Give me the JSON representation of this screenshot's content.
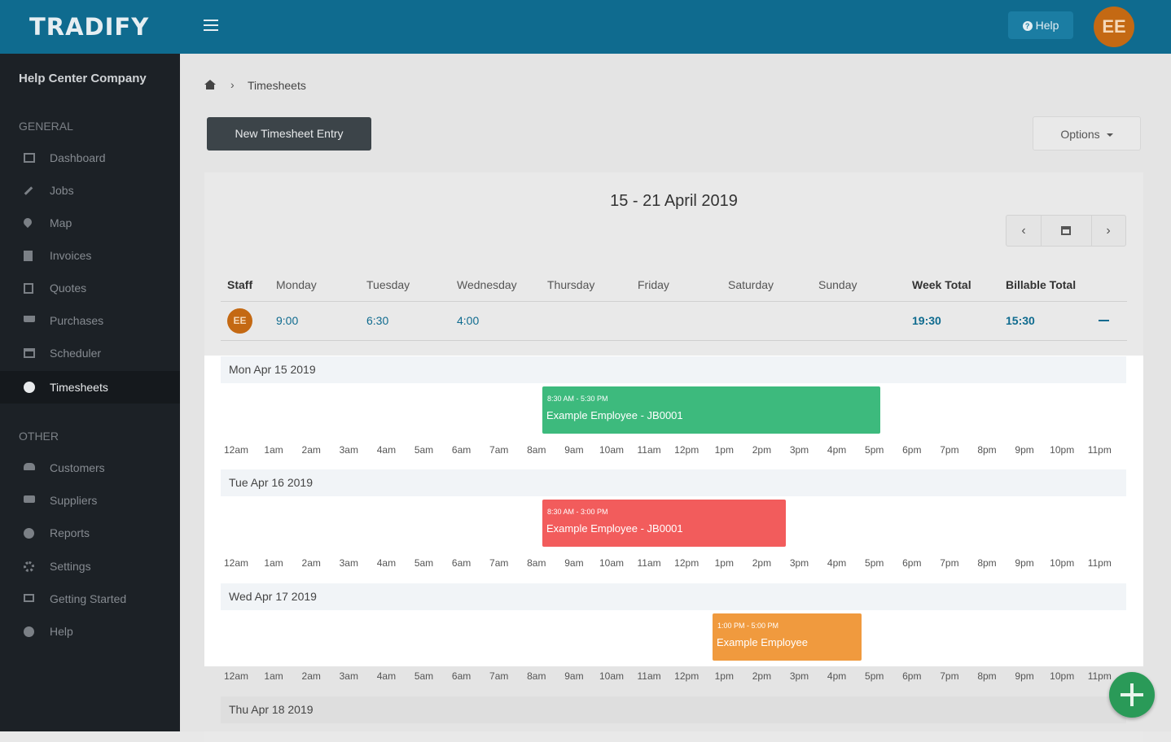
{
  "header": {
    "logo": "TRADIFY",
    "help_label": "Help",
    "user_initials": "EE"
  },
  "sidebar": {
    "company": "Help Center Company",
    "general_label": "GENERAL",
    "other_label": "OTHER",
    "general_items": [
      {
        "label": "Dashboard",
        "icon": "dashboard-icon"
      },
      {
        "label": "Jobs",
        "icon": "hammer-icon"
      },
      {
        "label": "Map",
        "icon": "map-pin-icon"
      },
      {
        "label": "Invoices",
        "icon": "invoice-icon"
      },
      {
        "label": "Quotes",
        "icon": "calculator-icon"
      },
      {
        "label": "Purchases",
        "icon": "cart-icon"
      },
      {
        "label": "Scheduler",
        "icon": "calendar-icon"
      },
      {
        "label": "Timesheets",
        "icon": "clock-icon",
        "active": true
      }
    ],
    "other_items": [
      {
        "label": "Customers",
        "icon": "users-icon"
      },
      {
        "label": "Suppliers",
        "icon": "truck-icon"
      },
      {
        "label": "Reports",
        "icon": "pie-chart-icon"
      },
      {
        "label": "Settings",
        "icon": "gear-icon"
      },
      {
        "label": "Getting Started",
        "icon": "thumbs-up-icon"
      },
      {
        "label": "Help",
        "icon": "question-icon"
      }
    ]
  },
  "breadcrumb": {
    "current": "Timesheets"
  },
  "toolbar": {
    "new_entry_label": "New Timesheet Entry",
    "options_label": "Options"
  },
  "week": {
    "title": "15 - 21 April 2019"
  },
  "table": {
    "headers": [
      "Staff",
      "Monday",
      "Tuesday",
      "Wednesday",
      "Thursday",
      "Friday",
      "Saturday",
      "Sunday",
      "Week Total",
      "Billable Total"
    ],
    "row": {
      "initials": "EE",
      "monday": "9:00",
      "tuesday": "6:30",
      "wednesday": "4:00",
      "week_total": "19:30",
      "billable_total": "15:30"
    }
  },
  "hours": [
    "12am",
    "1am",
    "2am",
    "3am",
    "4am",
    "5am",
    "6am",
    "7am",
    "8am",
    "9am",
    "10am",
    "11am",
    "12pm",
    "1pm",
    "2pm",
    "3pm",
    "4pm",
    "5pm",
    "6pm",
    "7pm",
    "8pm",
    "9pm",
    "10pm",
    "11pm"
  ],
  "days": [
    {
      "label": "Mon Apr 15 2019",
      "event": {
        "time": "8:30 AM - 5:30 PM",
        "title": "Example Employee - JB0001",
        "color": "#3dba7d"
      }
    },
    {
      "label": "Tue Apr 16 2019",
      "event": {
        "time": "8:30 AM - 3:00 PM",
        "title": "Example Employee - JB0001",
        "color": "#f25c5c"
      }
    },
    {
      "label": "Wed Apr 17 2019",
      "event": {
        "time": "1:00 PM - 5:00 PM",
        "title": "Example Employee",
        "color": "#f09a3e"
      }
    },
    {
      "label": "Thu Apr 18 2019"
    }
  ]
}
